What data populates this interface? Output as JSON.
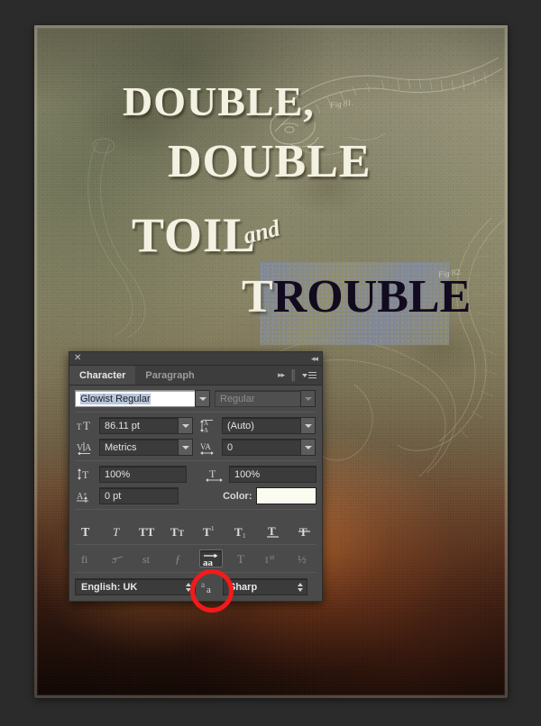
{
  "artwork": {
    "name": "vintage-poster-canvas",
    "lines": {
      "line1": "DOUBLE,",
      "line2": "DOUBLE",
      "line3": "TOIL",
      "line4_script": "and",
      "line5_selected_prefix": "T",
      "line5_selected_rest": "ROUBLE"
    },
    "fig_label_1": "Fig 81.",
    "fig_label_2": "Fig 82."
  },
  "panel": {
    "title_close": "✕",
    "collapse": "◂◂",
    "tabs": [
      {
        "label": "Character",
        "active": true
      },
      {
        "label": "Paragraph",
        "active": false
      }
    ],
    "expand_arrows": "▸▸",
    "font_family": {
      "value": "Glowist Regular",
      "icon": "font-family-field"
    },
    "font_style": {
      "value": "Regular",
      "disabled": true
    },
    "font_size": {
      "icon_name": "font-size-icon",
      "value": "86.11 pt"
    },
    "leading": {
      "icon_name": "leading-icon",
      "value": "(Auto)"
    },
    "kerning": {
      "icon_name": "kerning-icon",
      "value": "Metrics"
    },
    "tracking": {
      "icon_name": "tracking-icon",
      "value": "0"
    },
    "vertical_scale": {
      "icon_name": "vertical-scale-icon",
      "value": "100%"
    },
    "horizontal_scale": {
      "icon_name": "horizontal-scale-icon",
      "value": "100%"
    },
    "baseline_shift": {
      "icon_name": "baseline-shift-icon",
      "value": "0 pt"
    },
    "color": {
      "label": "Color:",
      "swatch_hex": "#fbfbf0"
    },
    "style_buttons": [
      {
        "name": "faux-bold-button",
        "glyph": "T",
        "state": "off"
      },
      {
        "name": "faux-italic-button",
        "glyph": "T",
        "state": "off"
      },
      {
        "name": "all-caps-button",
        "glyph": "TT",
        "state": "off"
      },
      {
        "name": "small-caps-button",
        "glyph": "TT",
        "state": "off"
      },
      {
        "name": "superscript-button",
        "glyph": "T1",
        "state": "off"
      },
      {
        "name": "subscript-button",
        "glyph": "T1",
        "state": "off"
      },
      {
        "name": "underline-button",
        "glyph": "T",
        "state": "off"
      },
      {
        "name": "strikethrough-button",
        "glyph": "T",
        "state": "off"
      }
    ],
    "opentype_buttons": [
      {
        "name": "standard-ligatures-button",
        "glyph": "fi",
        "state": "disabled"
      },
      {
        "name": "contextual-alternates-button",
        "glyph": "ɔ̵",
        "state": "disabled"
      },
      {
        "name": "discretionary-ligatures-button",
        "glyph": "st",
        "state": "disabled"
      },
      {
        "name": "swash-button",
        "glyph": "ƒ",
        "state": "disabled"
      },
      {
        "name": "stylistic-alternates-button",
        "glyph": "aa",
        "state": "active"
      },
      {
        "name": "titling-alternates-button",
        "glyph": "T",
        "state": "disabled"
      },
      {
        "name": "ordinals-button",
        "glyph": "1st",
        "state": "disabled"
      },
      {
        "name": "fractions-button",
        "glyph": "½",
        "state": "disabled"
      }
    ],
    "language": {
      "value": "English: UK"
    },
    "antialias_icon_name": "anti-aliasing-icon",
    "antialias": {
      "value": "Sharp"
    }
  },
  "annotation": {
    "name": "red-highlight-circle",
    "color": "#f41a1a",
    "targets": "stylistic-alternates-button"
  }
}
